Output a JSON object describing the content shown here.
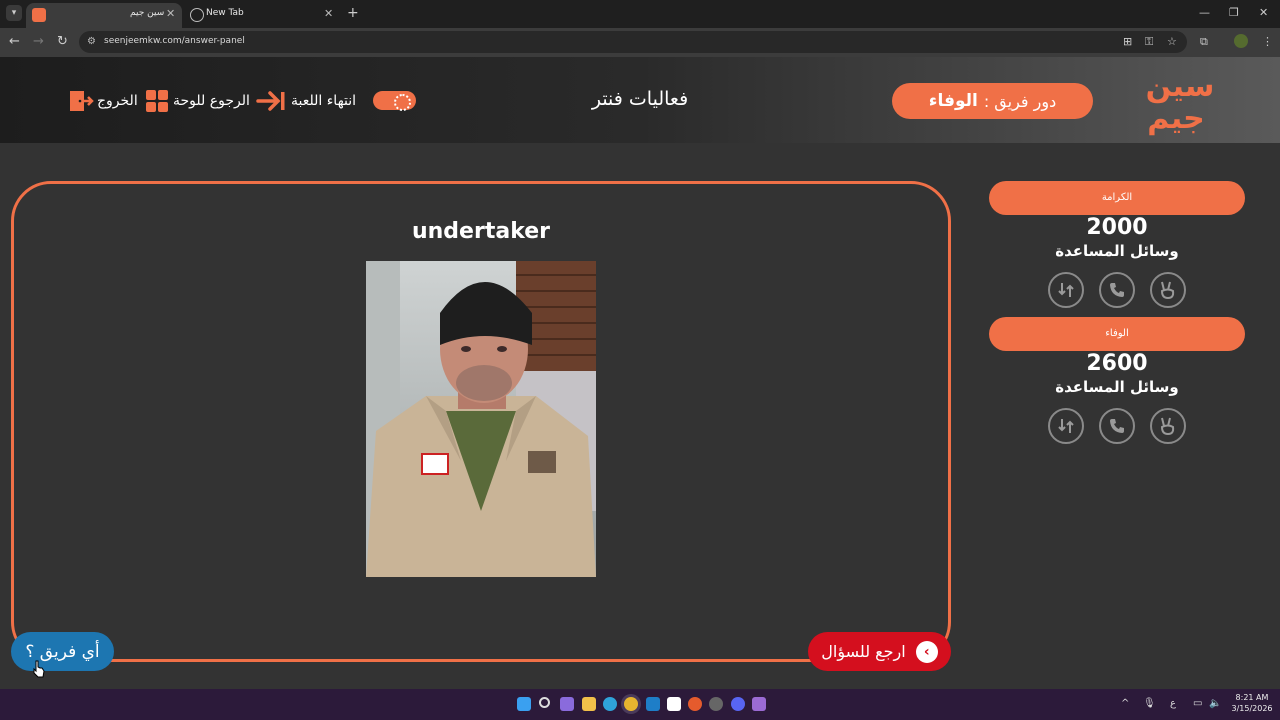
{
  "browser": {
    "tabs": [
      {
        "title": "سين جيم",
        "active": true
      },
      {
        "title": "New Tab",
        "active": false
      }
    ],
    "url": "seenjeemkw.com/answer-panel"
  },
  "header": {
    "exit_label": "الخروج",
    "back_to_board_label": "الرجوع للوحة",
    "end_game_label": "انتهاء اللعبة",
    "category_title": "فعاليات فنتر",
    "turn_prefix": "دور فريق :",
    "turn_team": "الوفاء",
    "logo_text_top": "سين",
    "logo_text_bottom": "جيم"
  },
  "answer": {
    "text": "undertaker",
    "image_desc": "portrait"
  },
  "buttons": {
    "which_team": "أي فريق ؟",
    "back_to_question": "ارجع للسؤال"
  },
  "teams": [
    {
      "name": "الكرامة",
      "score": "2000",
      "aids_label": "وسائل المساعدة"
    },
    {
      "name": "الوفاء",
      "score": "2600",
      "aids_label": "وسائل المساعدة"
    }
  ],
  "aid_icons": [
    "two-answers-icon",
    "phone-icon",
    "swap-icon"
  ],
  "colors": {
    "accent": "#f07047",
    "back_button": "#d40f1e",
    "team_button": "#1d76b1",
    "background": "#333333"
  },
  "taskbar": {
    "lang": "ع",
    "time": "8:21 AM",
    "date": "3/15/2026"
  }
}
